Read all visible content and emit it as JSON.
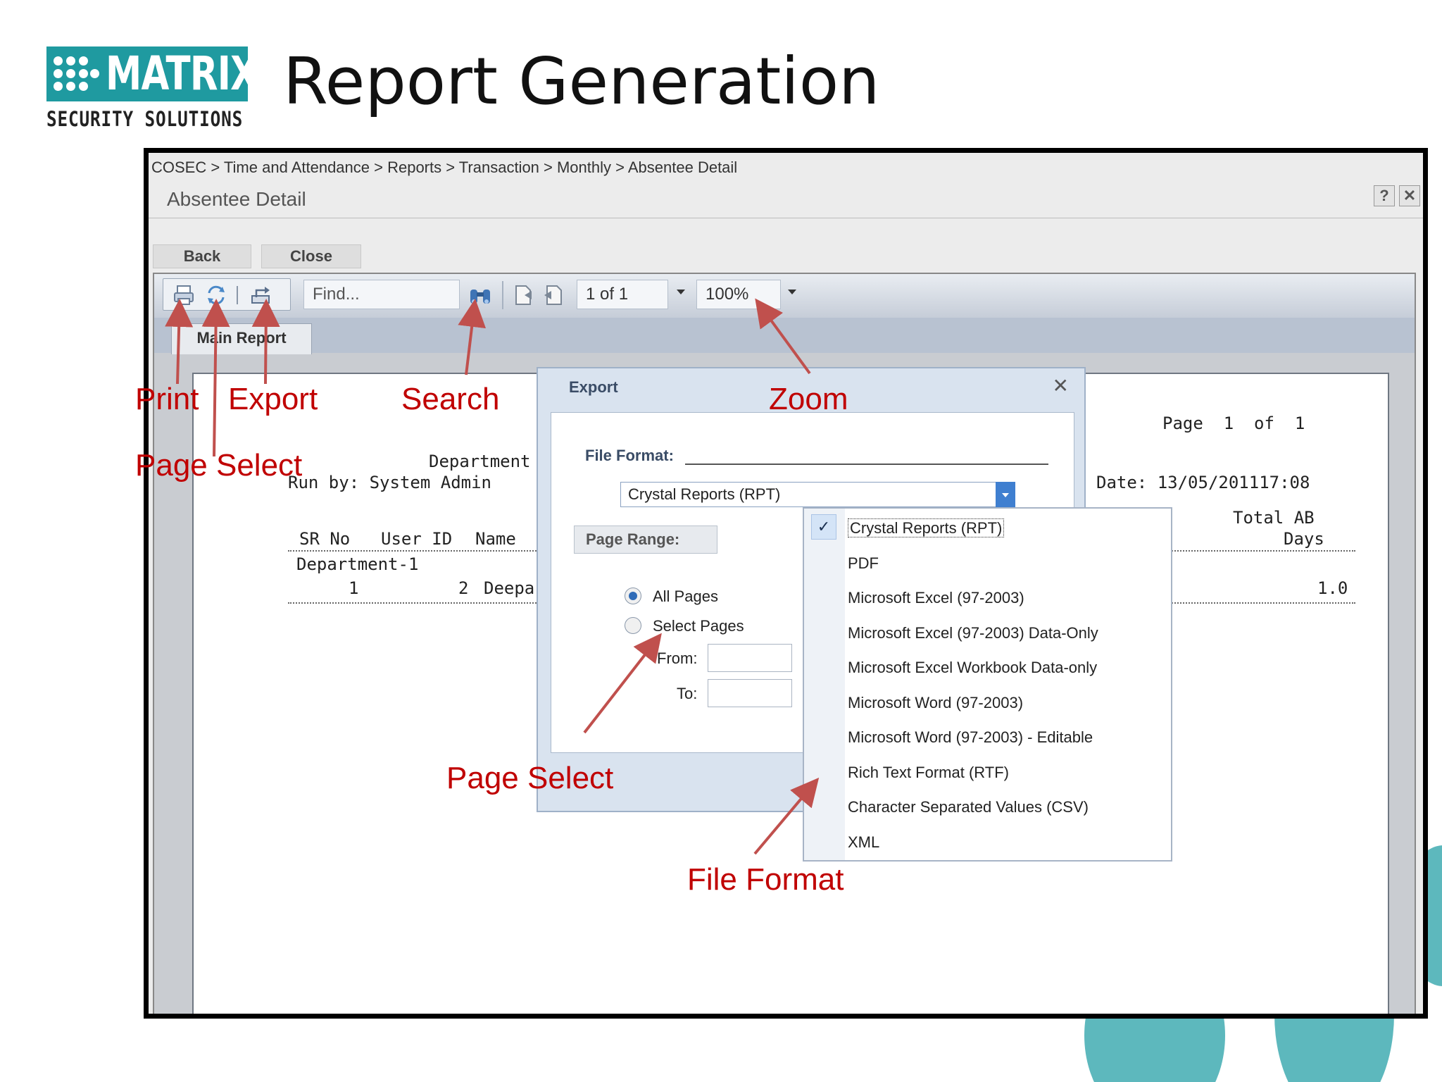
{
  "slide": {
    "logo_word": "MATRIX",
    "logo_sub": "SECURITY SOLUTIONS",
    "title": "Report Generation",
    "colors": {
      "teal": "#1f9aa0",
      "annotation": "#c00000"
    }
  },
  "breadcrumb": "COSEC > Time and Attendance > Reports > Transaction > Monthly > Absentee Detail",
  "window": {
    "title": "Absentee Detail",
    "help_label": "?",
    "close_label": "✕",
    "back_label": "Back",
    "close_button_label": "Close"
  },
  "viewer": {
    "icons": [
      "print-icon",
      "page-select-icon",
      "export-icon",
      "binoculars-search-icon",
      "first-page-icon",
      "prev-page-icon"
    ],
    "find_placeholder": "Find...",
    "page_value": "1 of 1",
    "zoom_value": "100%",
    "tab_label": "Main Report"
  },
  "report": {
    "page_info": "Page  1  of  1",
    "department_header": "Department",
    "run_by": "Run by: System Admin",
    "date": "Date: 13/05/201117:08",
    "columns": [
      "SR No",
      "User ID",
      "Name"
    ],
    "total_header_1": "Total AB",
    "total_header_2": "Days",
    "group": "Department-1",
    "row_sr": "1",
    "row_user_id": "2",
    "row_name": "Deepak",
    "row_total": "1.0"
  },
  "export_dialog": {
    "title": "Export",
    "close_label": "✕",
    "file_format_label": "File Format:",
    "selected_format": "Crystal Reports (RPT)",
    "page_range_label": "Page Range:",
    "all_pages_label": "All Pages",
    "select_pages_label": "Select Pages",
    "from_label": "From:",
    "to_label": "To:",
    "formats": [
      "Crystal Reports (RPT)",
      "PDF",
      "Microsoft Excel (97-2003)",
      "Microsoft Excel (97-2003) Data-Only",
      "Microsoft Excel Workbook Data-only",
      "Microsoft Word (97-2003)",
      "Microsoft Word (97-2003) - Editable",
      "Rich Text Format (RTF)",
      "Character Separated Values (CSV)",
      "XML"
    ],
    "check_mark": "✓"
  },
  "annotations": {
    "print": "Print",
    "export": "Export",
    "search": "Search",
    "zoom": "Zoom",
    "page_select_top": "Page Select",
    "page_select_dialog": "Page Select",
    "file_format": "File Format"
  }
}
